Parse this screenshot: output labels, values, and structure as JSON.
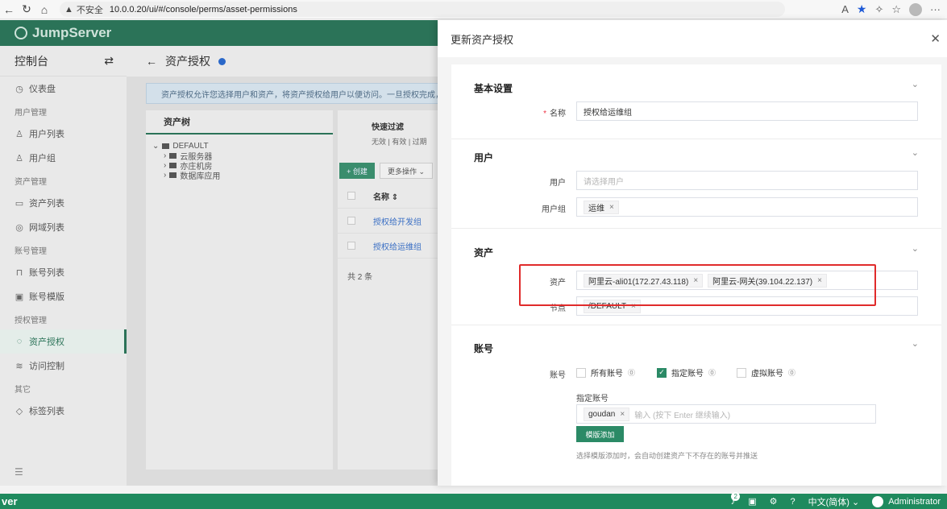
{
  "browser": {
    "insecure_label": "不安全",
    "url": "10.0.0.20/ui/#/console/perms/asset-permissions"
  },
  "app": {
    "logo": "JumpServer",
    "sidebar": {
      "title": "控制台",
      "items": [
        {
          "type": "item",
          "label": "仪表盘",
          "icon": "dashboard-icon"
        },
        {
          "type": "group",
          "label": "用户管理"
        },
        {
          "type": "item",
          "label": "用户列表",
          "icon": "user-icon"
        },
        {
          "type": "item",
          "label": "用户组",
          "icon": "user-group-icon"
        },
        {
          "type": "group",
          "label": "资产管理"
        },
        {
          "type": "item",
          "label": "资产列表",
          "icon": "monitor-icon"
        },
        {
          "type": "item",
          "label": "网域列表",
          "icon": "domain-icon"
        },
        {
          "type": "group",
          "label": "账号管理"
        },
        {
          "type": "item",
          "label": "账号列表",
          "icon": "lock-icon"
        },
        {
          "type": "item",
          "label": "账号模版",
          "icon": "template-icon"
        },
        {
          "type": "group",
          "label": "授权管理"
        },
        {
          "type": "item",
          "label": "资产授权",
          "icon": "shield-icon",
          "active": true
        },
        {
          "type": "item",
          "label": "访问控制",
          "icon": "access-control-icon"
        },
        {
          "type": "group",
          "label": "其它"
        },
        {
          "type": "item",
          "label": "标签列表",
          "icon": "tag-icon"
        }
      ]
    },
    "page_title": "资产授权",
    "alert": "资产授权允许您选择用户和资产，将资产授权给用户以便访问。一旦授权完成，用户",
    "tree": {
      "header": "资产树",
      "root": "DEFAULT",
      "children": [
        "云服务器",
        "亦庄机房",
        "数据库应用"
      ]
    },
    "filter": {
      "title": "快速过滤",
      "options": "无效 | 有效 | 过期"
    },
    "create_label": "+ 创建",
    "more_label": "更多操作 ⌄",
    "table": {
      "col_name": "名称 ⇕",
      "rows": [
        "授权给开发组",
        "授权给运维组"
      ],
      "total": "共 2 条"
    }
  },
  "drawer": {
    "title": "更新资产授权",
    "sections": {
      "basic": {
        "title": "基本设置",
        "name_label": "名称",
        "name_value": "授权给运维组"
      },
      "users": {
        "title": "用户",
        "user_label": "用户",
        "user_placeholder": "请选择用户",
        "group_label": "用户组",
        "group_tags": [
          "运维"
        ]
      },
      "assets": {
        "title": "资产",
        "asset_label": "资产",
        "asset_tags": [
          "阿里云-ali01(172.27.43.118)",
          "阿里云-网关(39.104.22.137)"
        ],
        "node_label": "节点",
        "node_tags": [
          "/DEFAULT"
        ]
      },
      "accounts": {
        "title": "账号",
        "label": "账号",
        "options": [
          {
            "label": "所有账号",
            "checked": false
          },
          {
            "label": "指定账号",
            "checked": true
          },
          {
            "label": "虚拟账号",
            "checked": false
          }
        ],
        "specified_label": "指定账号",
        "specified_tags": [
          "goudan"
        ],
        "input_placeholder": "输入 (按下 Enter 继续输入)",
        "template_button": "模版添加",
        "hint": "选择模版添加时，会自动创建资产下不存在的账号并推送"
      }
    }
  },
  "bottom": {
    "left_text": "ver",
    "notification_count": "2",
    "language": "中文(简体) ⌄",
    "user": "Administrator"
  },
  "colors": {
    "brand": "#2b7358",
    "accent": "#2b8a66",
    "highlight": "#e02b2b"
  }
}
